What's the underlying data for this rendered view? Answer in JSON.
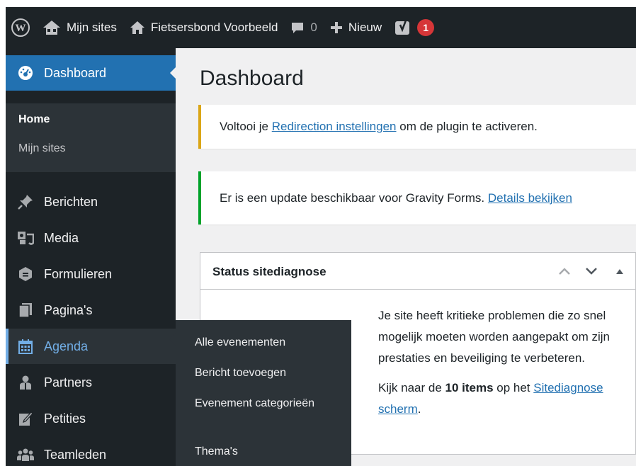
{
  "adminbar": {
    "my_sites": "Mijn sites",
    "site_name": "Fietsersbond Voorbeeld",
    "comments_count": "0",
    "new_label": "Nieuw",
    "yoast_badge": "1"
  },
  "sidebar": {
    "dashboard": "Dashboard",
    "dashboard_sub": [
      "Home",
      "Mijn sites"
    ],
    "items": [
      {
        "label": "Berichten",
        "icon": "pin-icon"
      },
      {
        "label": "Media",
        "icon": "media-icon"
      },
      {
        "label": "Formulieren",
        "icon": "forms-icon"
      },
      {
        "label": "Pagina's",
        "icon": "pages-icon"
      },
      {
        "label": "Agenda",
        "icon": "calendar-icon"
      },
      {
        "label": "Partners",
        "icon": "partners-icon"
      },
      {
        "label": "Petities",
        "icon": "petitions-icon"
      },
      {
        "label": "Teamleden",
        "icon": "team-icon"
      }
    ]
  },
  "flyout": {
    "items": [
      "Alle evenementen",
      "Bericht toevoegen",
      "Evenement categorieën",
      "Thema's"
    ]
  },
  "main": {
    "title": "Dashboard",
    "notice_redirection": {
      "prefix": "Voltooi je ",
      "link": "Redirection instellingen",
      "suffix": " om de plugin te activeren."
    },
    "notice_gravity": {
      "text": "Er is een update beschikbaar voor Gravity Forms. ",
      "link": "Details bekijken"
    },
    "site_health": {
      "title": "Status sitediagnose",
      "text1": "Je site heeft kritieke problemen die zo snel mogelijk moeten worden aangepakt om zijn prestaties en beveiliging te verbeteren.",
      "text2_prefix": "Kijk naar de ",
      "text2_bold": "10 items",
      "text2_suffix": " op het ",
      "link": "Sitediagnose scherm",
      "link_suffix": "."
    }
  },
  "colors": {
    "adminbar_bg": "#1d2327",
    "accent": "#2271b1",
    "submenu_bg": "#2c3338",
    "warning": "#dba617",
    "success": "#00a32a",
    "badge": "#d63638"
  }
}
